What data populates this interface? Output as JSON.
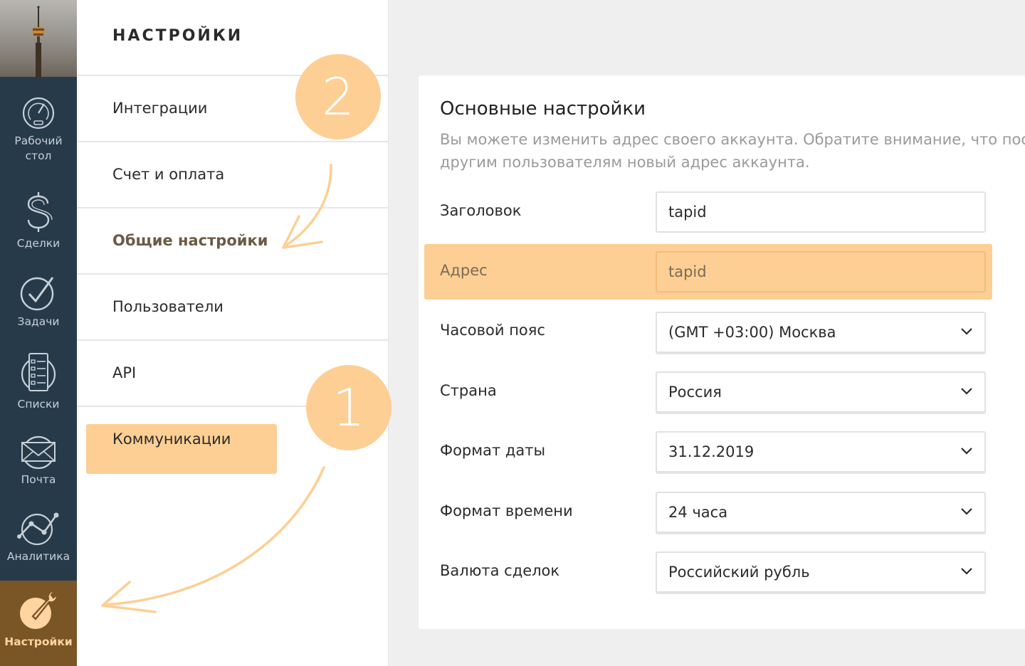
{
  "sidebar": {
    "items": [
      {
        "label": "Рабочий стол",
        "icon": "dashboard-gauge-icon"
      },
      {
        "label": "Сделки",
        "icon": "dollar-icon"
      },
      {
        "label": "Задачи",
        "icon": "checkmark-icon"
      },
      {
        "label": "Списки",
        "icon": "list-icon"
      },
      {
        "label": "Почта",
        "icon": "mail-icon"
      },
      {
        "label": "Аналитика",
        "icon": "analytics-icon"
      },
      {
        "label": "Настройки",
        "icon": "wrench-icon",
        "active": true
      }
    ]
  },
  "settings_menu": {
    "title": "НАСТРОЙКИ",
    "items": [
      {
        "label": "Интеграции"
      },
      {
        "label": "Счет и оплата"
      },
      {
        "label": "Общие настройки",
        "active": true
      },
      {
        "label": "Пользователи"
      },
      {
        "label": "API"
      },
      {
        "label": "Коммуникации"
      }
    ]
  },
  "annotations": {
    "step1": "1",
    "step2": "2",
    "highlight_color": "#fdcf94"
  },
  "main": {
    "title": "Основные настройки",
    "description_line1": "Вы можете изменить адрес своего аккаунта. Обратите внимание, что после",
    "description_line2": "другим пользователям новый адрес аккаунта.",
    "fields": [
      {
        "label": "Заголовок",
        "value": "tapid",
        "type": "text"
      },
      {
        "label": "Адрес",
        "value": "tapid",
        "type": "text",
        "highlighted": true
      },
      {
        "label": "Часовой пояс",
        "value": "(GMT +03:00) Москва",
        "type": "select"
      },
      {
        "label": "Страна",
        "value": "Россия",
        "type": "select"
      },
      {
        "label": "Формат даты",
        "value": "31.12.2019",
        "type": "select"
      },
      {
        "label": "Формат времени",
        "value": "24 часа",
        "type": "select"
      },
      {
        "label": "Валюта сделок",
        "value": "Российский рубль",
        "type": "select"
      }
    ]
  },
  "colors": {
    "sidebar_bg": "#273a49",
    "sidebar_active_bg": "#7a5526",
    "accent": "#fdcf94"
  }
}
